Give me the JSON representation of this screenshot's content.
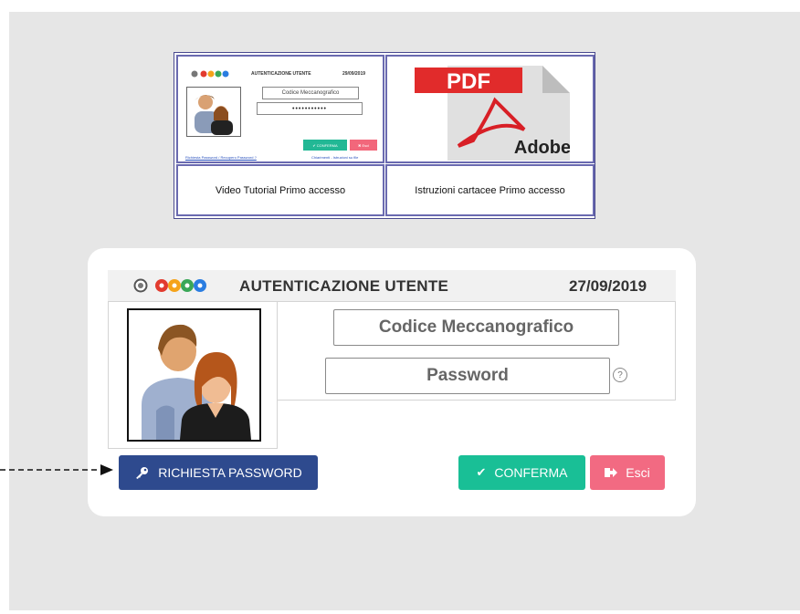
{
  "top_grid": {
    "cells": [
      {
        "label": "Video Tutorial Primo accesso"
      },
      {
        "label": "Istruzioni cartacee Primo accesso"
      }
    ],
    "preview": {
      "title": "AUTENTICAZIONE UTENTE",
      "date": "29/09/2019",
      "code_field": "Codice Meccanografico",
      "password_dots": "•••••••••••",
      "confirm": "✔ CONFERMA",
      "exit": "✖ Esci",
      "link_left": "Richiesta Password / Recupero Password ?",
      "link_right": "Chiarimenti - Istruzioni su file"
    },
    "pdf": {
      "badge": "PDF",
      "brand": "Adobe"
    }
  },
  "login": {
    "title": "AUTENTICAZIONE UTENTE",
    "date": "27/09/2019",
    "code_placeholder": "Codice Meccanografico",
    "password_placeholder": "Password",
    "help": "?",
    "request_password": "RICHIESTA PASSWORD",
    "confirm": "CONFERMA",
    "exit": "Esci"
  },
  "colors": {
    "blue": "#2e4a8e",
    "green": "#19bf96",
    "red": "#f26a82",
    "pdf_red": "#e12b2b"
  },
  "icons": [
    "key-icon",
    "check-icon",
    "exit-icon",
    "help-icon",
    "pdf-icon",
    "user-avatar-icon",
    "logo-icon"
  ]
}
